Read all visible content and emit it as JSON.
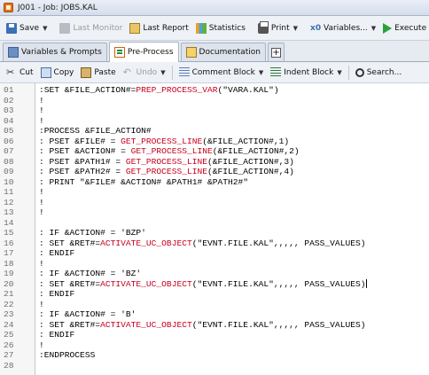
{
  "window": {
    "title": "J001 - Job: JOBS.KAL"
  },
  "toolbar1": [
    {
      "name": "save-button",
      "icon": "save-icon",
      "label": "Save",
      "dropdown": true,
      "disabled": false
    },
    {
      "name": "last-monitor-button",
      "icon": "monitor-icon",
      "label": "Last Monitor",
      "dropdown": false,
      "disabled": true
    },
    {
      "name": "last-report-button",
      "icon": "report-icon",
      "label": "Last Report",
      "dropdown": false,
      "disabled": false
    },
    {
      "name": "statistics-button",
      "icon": "statistics-icon",
      "label": "Statistics",
      "dropdown": false,
      "disabled": false
    },
    {
      "name": "print-button",
      "icon": "print-icon",
      "label": "Print",
      "dropdown": true,
      "disabled": false
    },
    {
      "name": "variables-button",
      "icon": "variables-icon",
      "label": "Variables...",
      "dropdown": true,
      "disabled": false
    },
    {
      "name": "execute-button",
      "icon": "execute-icon",
      "label": "Execute",
      "dropdown": true,
      "disabled": false
    }
  ],
  "tabs": [
    {
      "name": "tab-variables-prompts",
      "icon": "variables-prompts-icon",
      "label": "Variables & Prompts",
      "active": false
    },
    {
      "name": "tab-pre-process",
      "icon": "pre-process-icon",
      "label": "Pre-Process",
      "active": true
    },
    {
      "name": "tab-documentation",
      "icon": "documentation-icon",
      "label": "Documentation",
      "active": false
    }
  ],
  "toolbar3": [
    {
      "name": "cut-button",
      "icon": "cut-icon",
      "label": "Cut",
      "dropdown": false,
      "disabled": false
    },
    {
      "name": "copy-button",
      "icon": "copy-icon",
      "label": "Copy",
      "dropdown": false,
      "disabled": false
    },
    {
      "name": "paste-button",
      "icon": "paste-icon",
      "label": "Paste",
      "dropdown": false,
      "disabled": false
    },
    {
      "name": "undo-button",
      "icon": "undo-icon",
      "label": "Undo",
      "dropdown": true,
      "disabled": true
    },
    {
      "name": "comment-block-button",
      "icon": "comment-block-icon",
      "label": "Comment Block",
      "dropdown": true,
      "disabled": false
    },
    {
      "name": "indent-block-button",
      "icon": "indent-block-icon",
      "label": "Indent Block",
      "dropdown": true,
      "disabled": false
    },
    {
      "name": "search-button",
      "icon": "search-icon",
      "label": "Search...",
      "dropdown": false,
      "disabled": false
    }
  ],
  "editor": {
    "lines": [
      {
        "num": "01",
        "text": ":SET &FILE_ACTION#=PREP_PROCESS_VAR(\"VARA.KAL\")"
      },
      {
        "num": "02",
        "text": "!"
      },
      {
        "num": "03",
        "text": "!"
      },
      {
        "num": "04",
        "text": "!"
      },
      {
        "num": "05",
        "text": ":PROCESS &FILE_ACTION#"
      },
      {
        "num": "06",
        "text": ": PSET &FILE# = GET_PROCESS_LINE(&FILE_ACTION#,1)"
      },
      {
        "num": "07",
        "text": ": PSET &ACTION# = GET_PROCESS_LINE(&FILE_ACTION#,2)"
      },
      {
        "num": "08",
        "text": ": PSET &PATH1# = GET_PROCESS_LINE(&FILE_ACTION#,3)"
      },
      {
        "num": "09",
        "text": ": PSET &PATH2# = GET_PROCESS_LINE(&FILE_ACTION#,4)"
      },
      {
        "num": "10",
        "text": ": PRINT \"&FILE# &ACTION# &PATH1# &PATH2#\""
      },
      {
        "num": "11",
        "text": "!"
      },
      {
        "num": "12",
        "text": "!"
      },
      {
        "num": "13",
        "text": "!"
      },
      {
        "num": "14",
        "text": ""
      },
      {
        "num": "15",
        "text": ": IF &ACTION# = 'BZP'"
      },
      {
        "num": "16",
        "text": ": SET &RET#=ACTIVATE_UC_OBJECT(\"EVNT.FILE.KAL\",,,,, PASS_VALUES)"
      },
      {
        "num": "17",
        "text": ": ENDIF"
      },
      {
        "num": "18",
        "text": "!"
      },
      {
        "num": "19",
        "text": ": IF &ACTION# = 'BZ'"
      },
      {
        "num": "20",
        "text": ": SET &RET#=ACTIVATE_UC_OBJECT(\"EVNT.FILE.KAL\",,,,, PASS_VALUES)"
      },
      {
        "num": "21",
        "text": ": ENDIF"
      },
      {
        "num": "22",
        "text": "!"
      },
      {
        "num": "23",
        "text": ": IF &ACTION# = 'B'"
      },
      {
        "num": "24",
        "text": ": SET &RET#=ACTIVATE_UC_OBJECT(\"EVNT.FILE.KAL\",,,,, PASS_VALUES)"
      },
      {
        "num": "25",
        "text": ": ENDIF"
      },
      {
        "num": "26",
        "text": "!"
      },
      {
        "num": "27",
        "text": ":ENDPROCESS"
      },
      {
        "num": "28",
        "text": ""
      }
    ],
    "highlighted_functions": [
      "PREP_PROCESS_VAR",
      "GET_PROCESS_LINE",
      "ACTIVATE_UC_OBJECT"
    ],
    "function_color": "#c8001e",
    "cursor_line": "20"
  }
}
